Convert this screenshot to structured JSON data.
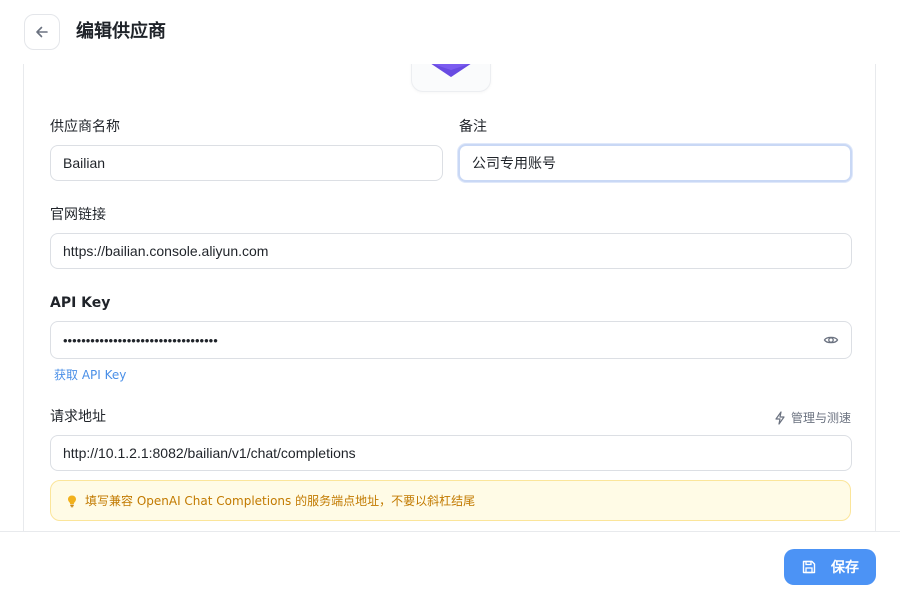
{
  "header": {
    "title": "编辑供应商"
  },
  "form": {
    "name": {
      "label": "供应商名称",
      "value": "Bailian"
    },
    "note": {
      "label": "备注",
      "value": "公司专用账号"
    },
    "website": {
      "label": "官网链接",
      "value": "https://bailian.console.aliyun.com"
    },
    "api_key": {
      "label": "API Key",
      "value": "••••••••••••••••••••••••••••••••••",
      "get_link": "获取 API Key"
    },
    "endpoint": {
      "label": "请求地址",
      "manage_label": "管理与测速",
      "value": "http://10.1.2.1:8082/bailian/v1/chat/completions",
      "hint": "填写兼容 OpenAI Chat Completions 的服务端点地址，不要以斜杠结尾"
    }
  },
  "footer": {
    "save_label": "保存"
  },
  "colors": {
    "accent": "#4c93f5",
    "logo": "#7b5cf0",
    "hint_bg": "#fffbe6",
    "hint_text": "#c27a00",
    "link": "#4a8fe7"
  }
}
